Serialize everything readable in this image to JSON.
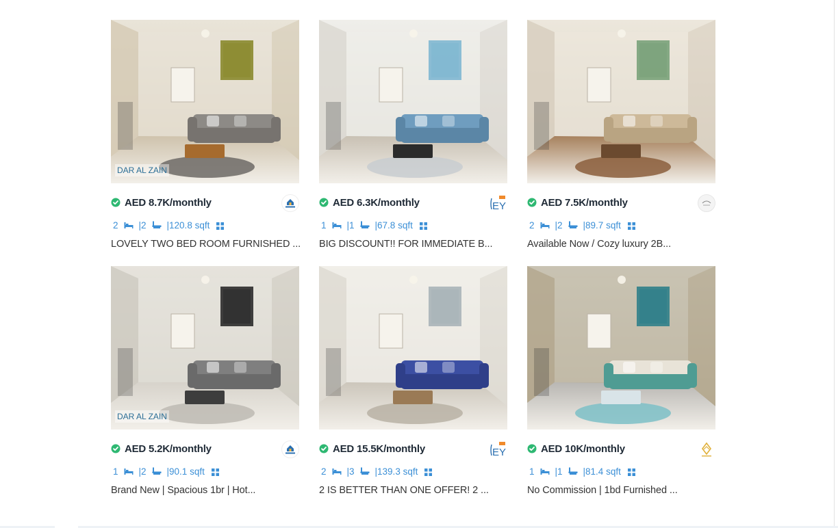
{
  "listings": [
    {
      "price": "AED 8.7K/monthly",
      "beds": "2",
      "baths": "|2",
      "area": "|120.8 sqft",
      "title": "LOVELY TWO BED ROOM FURNISHED ...",
      "watermark": "DAR AL ZAIN",
      "agency": "LIKE HOME",
      "scene": "living-beige"
    },
    {
      "price": "AED 6.3K/monthly",
      "beds": "1",
      "baths": "|1",
      "area": "|67.8 sqft",
      "title": "BIG DISCOUNT!! FOR IMMEDIATE B...",
      "watermark": "",
      "agency": "EY",
      "scene": "living-blue"
    },
    {
      "price": "AED 7.5K/monthly",
      "beds": "2",
      "baths": "|2",
      "area": "|89.7 sqft",
      "title": "Available Now / Cozy luxury 2B...",
      "watermark": "",
      "agency": "",
      "scene": "living-tan"
    },
    {
      "price": "AED 5.2K/monthly",
      "beds": "1",
      "baths": "|2",
      "area": "|90.1 sqft",
      "title": "Brand New | Spacious 1br | Hot...",
      "watermark": "DAR AL ZAIN",
      "agency": "LIKE HOME",
      "scene": "living-grey"
    },
    {
      "price": "AED 15.5K/monthly",
      "beds": "2",
      "baths": "|3",
      "area": "|139.3 sqft",
      "title": "2 IS BETTER THAN ONE OFFER! 2 ...",
      "watermark": "",
      "agency": "EY",
      "scene": "living-navy"
    },
    {
      "price": "AED 10K/monthly",
      "beds": "1",
      "baths": "|1",
      "area": "|81.4 sqft",
      "title": "No Commission | 1bd Furnished ...",
      "watermark": "",
      "agency": "SPRUCE",
      "scene": "living-teal"
    }
  ],
  "colors": {
    "accent": "#3b8fd6",
    "verified": "#2eb872",
    "price": "#1f2a36",
    "text": "#333333"
  }
}
